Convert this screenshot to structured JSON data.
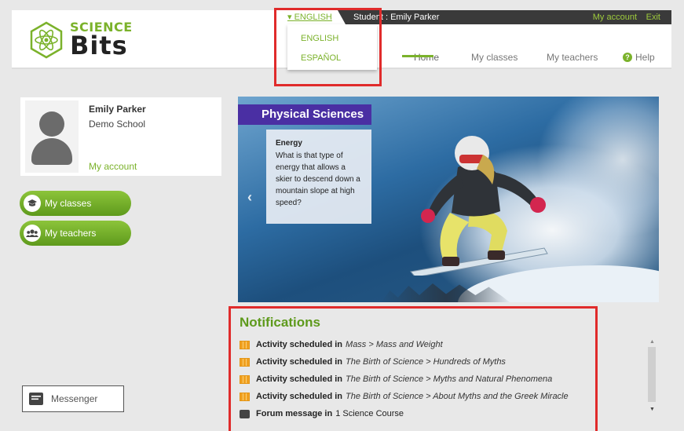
{
  "topbar": {
    "current_language": "ENGLISH",
    "student_label": "Student : Emily Parker",
    "my_account": "My account",
    "exit": "Exit"
  },
  "logo": {
    "line1": "SCIENCE",
    "line2": "Bits"
  },
  "nav": {
    "home": "Home",
    "my_classes": "My classes",
    "my_teachers": "My teachers",
    "help": "Help"
  },
  "language_dropdown": {
    "options": [
      "ENGLISH",
      "ESPAÑOL"
    ]
  },
  "profile": {
    "name": "Emily Parker",
    "school": "Demo School",
    "account_link": "My account"
  },
  "sidebar_buttons": {
    "my_classes": "My classes",
    "my_teachers": "My teachers"
  },
  "messenger": {
    "label": "Messenger"
  },
  "hero": {
    "title": "Physical Sciences",
    "card_title": "Energy",
    "card_text": "What is that type of energy that allows a skier to descend down a mountain slope at high speed?",
    "prev_arrow": "‹"
  },
  "notifications": {
    "title": "Notifications",
    "items": [
      {
        "type": "activity",
        "prefix": "Activity scheduled in",
        "path": "Mass > Mass and Weight"
      },
      {
        "type": "activity",
        "prefix": "Activity scheduled in",
        "path": "The Birth of Science > Hundreds of Myths"
      },
      {
        "type": "activity",
        "prefix": "Activity scheduled in",
        "path": "The Birth of Science > Myths and Natural Phenomena"
      },
      {
        "type": "activity",
        "prefix": "Activity scheduled in",
        "path": "The Birth of Science > About Myths and the Greek Miracle"
      },
      {
        "type": "forum",
        "prefix": "Forum message in",
        "path": "1 Science Course"
      }
    ]
  },
  "colors": {
    "brand_green": "#7bb22b",
    "hero_title_bg": "#4a2fa3",
    "highlight_red": "#e02b2b"
  }
}
